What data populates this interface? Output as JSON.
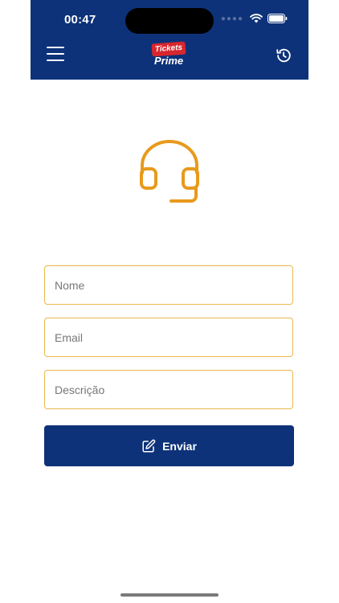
{
  "status_bar": {
    "time": "00:47",
    "signal_icon": "signal-dots-icon",
    "wifi_icon": "wifi-icon",
    "battery_icon": "battery-icon"
  },
  "header": {
    "menu_icon": "hamburger-menu-icon",
    "logo": {
      "line1": "Tickets",
      "line2": "Prime",
      "accent": "#d8262e"
    },
    "history_icon": "history-icon",
    "background": "#0d3279"
  },
  "hero": {
    "icon": "headset-icon",
    "color": "#e89a1c"
  },
  "form": {
    "name_placeholder": "Nome",
    "email_placeholder": "Email",
    "description_placeholder": "Descrição",
    "border_color": "#e9b84a"
  },
  "submit": {
    "label": "Enviar",
    "icon": "edit-icon",
    "background": "#0d3279"
  }
}
